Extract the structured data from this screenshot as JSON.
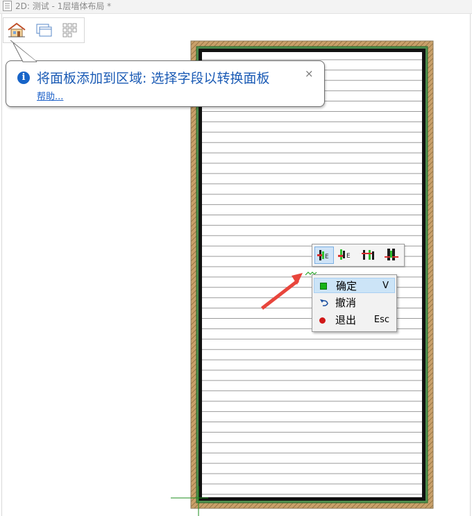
{
  "window": {
    "title": "2D: 测试 - 1层墙体布局 *"
  },
  "view_toolbar": {
    "buttons": [
      "home-view-icon",
      "windows-icon",
      "grid-view-icon"
    ]
  },
  "tooltip": {
    "message": "将面板添加到区域: 选择字段以转换面板",
    "help_link": "帮助...",
    "close": "×"
  },
  "panel_toolbar": {
    "buttons": [
      "panel-mode-1-icon",
      "panel-mode-2-icon",
      "panel-mode-3-icon",
      "panel-mode-4-icon"
    ],
    "active_index": 0
  },
  "context_menu": {
    "items": [
      {
        "label": "确定",
        "shortcut": "V",
        "icon": "green-square-icon"
      },
      {
        "label": "撤消",
        "shortcut": "",
        "icon": "undo-icon"
      },
      {
        "label": "退出",
        "shortcut": "Esc",
        "icon": "red-dot-icon"
      }
    ],
    "highlighted_index": 0
  },
  "colors": {
    "wall_hatch": "#b8925a",
    "panel_outline": "#2e8b2e",
    "board_line": "#9a9a9a",
    "annotation_arrow": "#e8453c",
    "accent_blue": "#1b5bb5"
  }
}
